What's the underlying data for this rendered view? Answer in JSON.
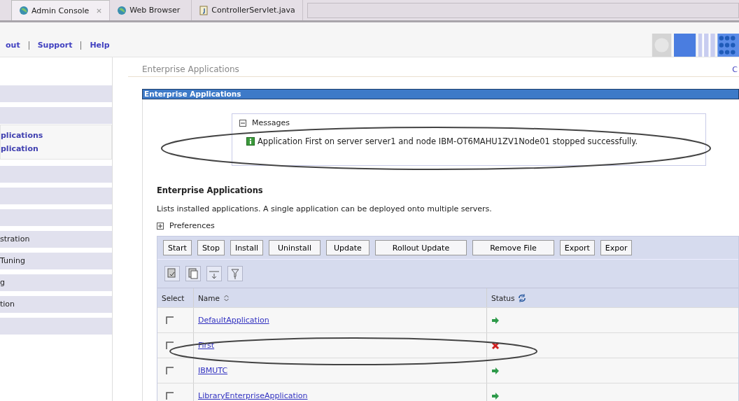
{
  "tabs": [
    {
      "label": "Admin Console",
      "kind": "web",
      "closable": true,
      "selected": true
    },
    {
      "label": "Web Browser",
      "kind": "web",
      "closable": false,
      "selected": false
    },
    {
      "label": "ControllerServlet.java",
      "kind": "file",
      "closable": false,
      "selected": false
    }
  ],
  "nav_links": [
    "out",
    "Support",
    "Help"
  ],
  "sidebar": {
    "items": [
      {
        "kind": "item"
      },
      {
        "kind": "item"
      },
      {
        "kind": "group",
        "links": [
          "plications",
          "plication"
        ]
      },
      {
        "kind": "item"
      },
      {
        "kind": "item"
      },
      {
        "kind": "item"
      },
      {
        "kind": "item",
        "label": "stration"
      },
      {
        "kind": "item",
        "label": "Tuning"
      },
      {
        "kind": "item",
        "label": "g"
      },
      {
        "kind": "item",
        "label": "tion"
      },
      {
        "kind": "item"
      }
    ]
  },
  "breadcrumb": "Enterprise Applications",
  "corner_link": "C",
  "panel": {
    "title": "Enterprise Applications",
    "messages": {
      "title": "Messages",
      "expanded": true,
      "text": "Application First on server server1 and node IBM-OT6MAHU1ZV1Node01 stopped successfully."
    },
    "heading": "Enterprise Applications",
    "description": "Lists installed applications. A single application can be deployed onto multiple servers.",
    "preferences": {
      "label": "Preferences",
      "expanded": false
    },
    "buttons": [
      "Start",
      "Stop",
      "Install",
      "Uninstall",
      "Update",
      "Rollout Update",
      "Remove File",
      "Export",
      "Expor"
    ],
    "table": {
      "columns": [
        "Select",
        "Name",
        "Status"
      ],
      "rows": [
        {
          "name": "DefaultApplication",
          "checked": false,
          "running": true
        },
        {
          "name": "First",
          "checked": false,
          "running": false
        },
        {
          "name": "IBMUTC",
          "checked": false,
          "running": true
        },
        {
          "name": "LibraryEnterpriseApplication",
          "checked": false,
          "running": true
        }
      ]
    }
  }
}
